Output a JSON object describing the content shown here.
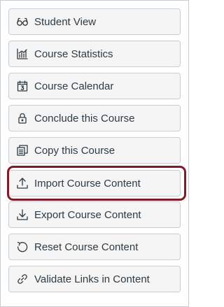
{
  "menu": {
    "items": [
      {
        "label": "Student View",
        "icon": "glasses-icon"
      },
      {
        "label": "Course Statistics",
        "icon": "stats-icon"
      },
      {
        "label": "Course Calendar",
        "icon": "calendar-icon"
      },
      {
        "label": "Conclude this Course",
        "icon": "lock-icon"
      },
      {
        "label": "Copy this Course",
        "icon": "copy-icon"
      },
      {
        "label": "Import Course Content",
        "icon": "upload-icon"
      },
      {
        "label": "Export Course Content",
        "icon": "download-icon"
      },
      {
        "label": "Reset Course Content",
        "icon": "reset-icon"
      },
      {
        "label": "Validate Links in Content",
        "icon": "link-icon"
      }
    ],
    "highlighted_item": "Import Course Content"
  },
  "colors": {
    "item_background": "#f5f5f5",
    "item_border": "#c7cdd1",
    "text": "#2d3b45",
    "highlight_border": "#7e1b26"
  }
}
